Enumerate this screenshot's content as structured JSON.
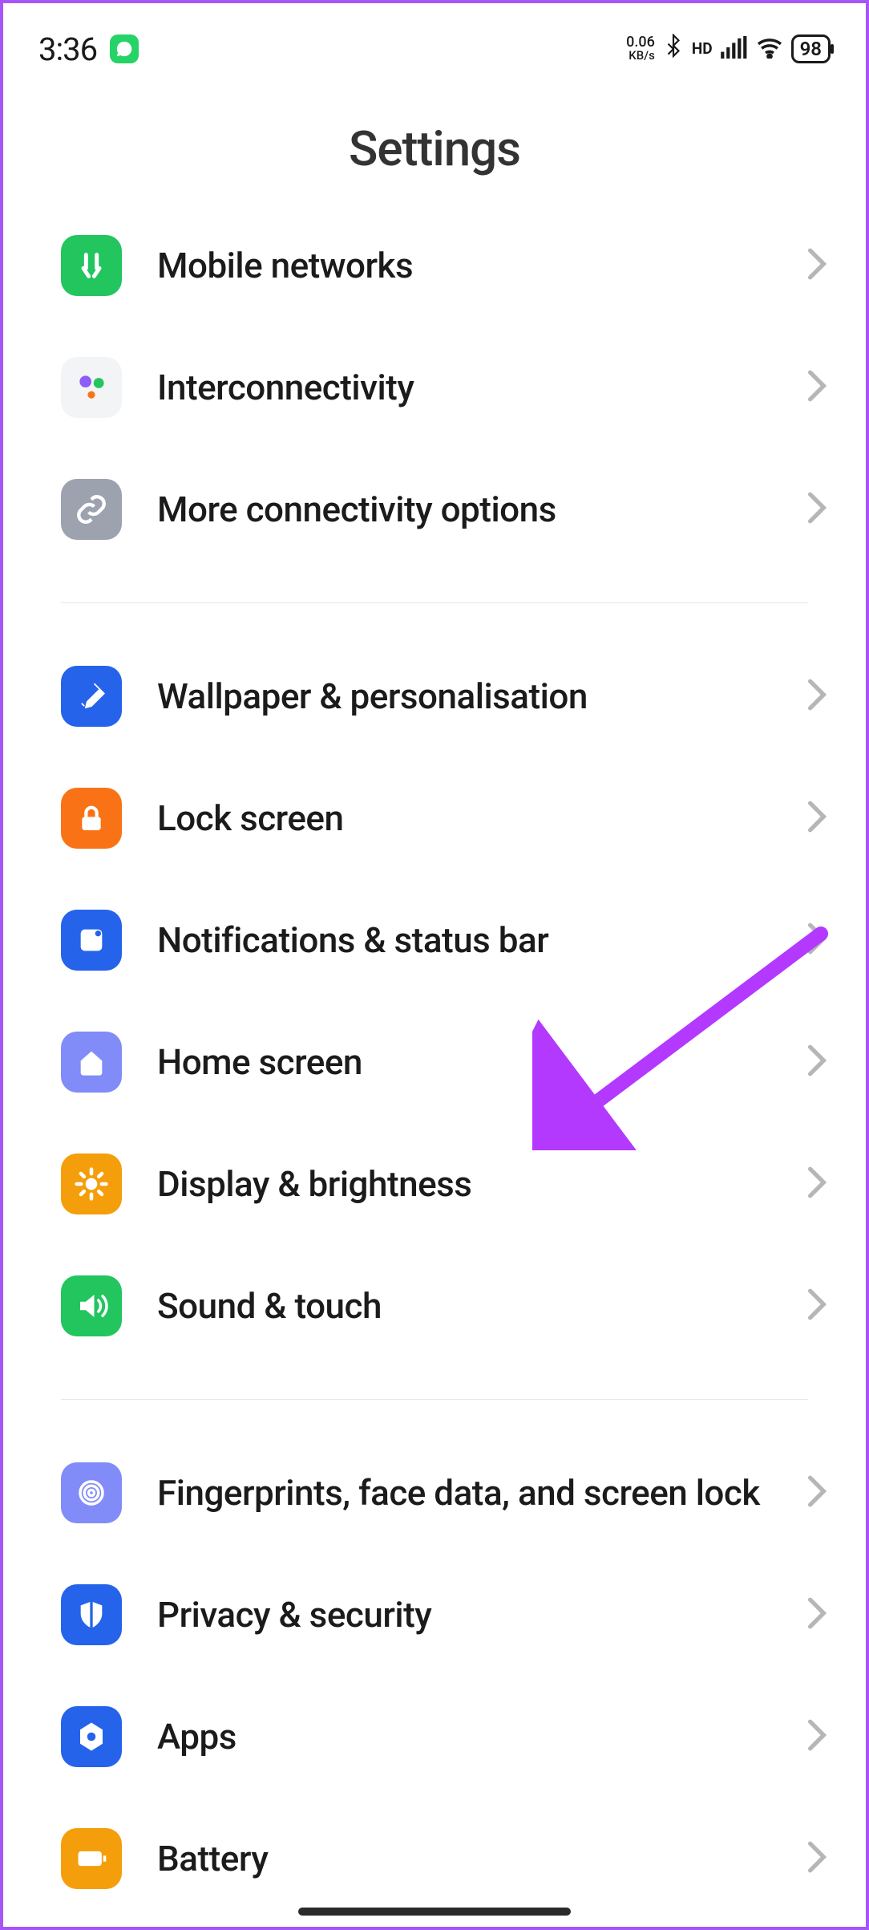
{
  "status_bar": {
    "time": "3:36",
    "net_speed_value": "0.06",
    "net_speed_unit": "KB/s",
    "hd_label": "HD",
    "battery_percent": "98"
  },
  "title": "Settings",
  "groups": [
    {
      "items": [
        {
          "id": "mobile-networks",
          "label": "Mobile networks",
          "icon": "sim-icon",
          "color": "#22c55e",
          "shape": "rect"
        },
        {
          "id": "interconnectivity",
          "label": "Interconnectivity",
          "icon": "dots-icon",
          "color": "#f3f4f6",
          "shape": "rect"
        },
        {
          "id": "more-connectivity",
          "label": "More connectivity options",
          "icon": "link-icon",
          "color": "#9ca3af",
          "shape": "rect"
        }
      ]
    },
    {
      "items": [
        {
          "id": "wallpaper",
          "label": "Wallpaper & personalisation",
          "icon": "brush-icon",
          "color": "#2563eb",
          "shape": "rect"
        },
        {
          "id": "lock-screen",
          "label": "Lock screen",
          "icon": "lock-icon",
          "color": "#f97316",
          "shape": "rect"
        },
        {
          "id": "notifications",
          "label": "Notifications & status bar",
          "icon": "tile-icon",
          "color": "#2563eb",
          "shape": "rect"
        },
        {
          "id": "home-screen",
          "label": "Home screen",
          "icon": "home-icon",
          "color": "#818cf8",
          "shape": "rect"
        },
        {
          "id": "display",
          "label": "Display & brightness",
          "icon": "sun-icon",
          "color": "#f59e0b",
          "shape": "rect"
        },
        {
          "id": "sound",
          "label": "Sound & touch",
          "icon": "speaker-icon",
          "color": "#22c55e",
          "shape": "rect"
        }
      ]
    },
    {
      "items": [
        {
          "id": "biometrics",
          "label": "Fingerprints, face data, and screen lock",
          "icon": "fingerprint-icon",
          "color": "#818cf8",
          "shape": "rect"
        },
        {
          "id": "privacy",
          "label": "Privacy & security",
          "icon": "shield-icon",
          "color": "#2563eb",
          "shape": "rect"
        },
        {
          "id": "apps",
          "label": "Apps",
          "icon": "hex-icon",
          "color": "#2563eb",
          "shape": "rect"
        },
        {
          "id": "battery",
          "label": "Battery",
          "icon": "battery-icon",
          "color": "#f59e0b",
          "shape": "rect"
        }
      ]
    }
  ],
  "annotation": {
    "points_to": "display",
    "color": "#b339ff"
  }
}
